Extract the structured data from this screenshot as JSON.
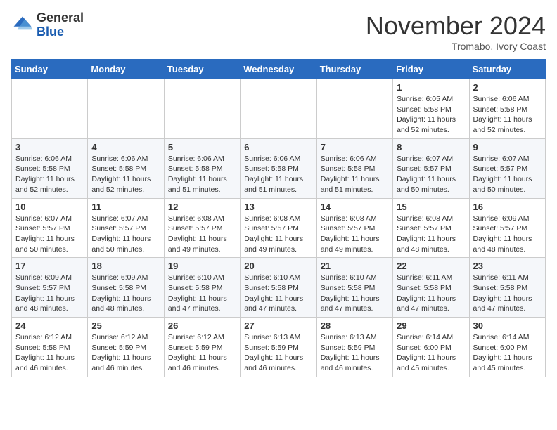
{
  "header": {
    "logo_general": "General",
    "logo_blue": "Blue",
    "month_title": "November 2024",
    "location": "Tromabo, Ivory Coast"
  },
  "days_of_week": [
    "Sunday",
    "Monday",
    "Tuesday",
    "Wednesday",
    "Thursday",
    "Friday",
    "Saturday"
  ],
  "weeks": [
    [
      {
        "day": "",
        "info": ""
      },
      {
        "day": "",
        "info": ""
      },
      {
        "day": "",
        "info": ""
      },
      {
        "day": "",
        "info": ""
      },
      {
        "day": "",
        "info": ""
      },
      {
        "day": "1",
        "info": "Sunrise: 6:05 AM\nSunset: 5:58 PM\nDaylight: 11 hours and 52 minutes."
      },
      {
        "day": "2",
        "info": "Sunrise: 6:06 AM\nSunset: 5:58 PM\nDaylight: 11 hours and 52 minutes."
      }
    ],
    [
      {
        "day": "3",
        "info": "Sunrise: 6:06 AM\nSunset: 5:58 PM\nDaylight: 11 hours and 52 minutes."
      },
      {
        "day": "4",
        "info": "Sunrise: 6:06 AM\nSunset: 5:58 PM\nDaylight: 11 hours and 52 minutes."
      },
      {
        "day": "5",
        "info": "Sunrise: 6:06 AM\nSunset: 5:58 PM\nDaylight: 11 hours and 51 minutes."
      },
      {
        "day": "6",
        "info": "Sunrise: 6:06 AM\nSunset: 5:58 PM\nDaylight: 11 hours and 51 minutes."
      },
      {
        "day": "7",
        "info": "Sunrise: 6:06 AM\nSunset: 5:58 PM\nDaylight: 11 hours and 51 minutes."
      },
      {
        "day": "8",
        "info": "Sunrise: 6:07 AM\nSunset: 5:57 PM\nDaylight: 11 hours and 50 minutes."
      },
      {
        "day": "9",
        "info": "Sunrise: 6:07 AM\nSunset: 5:57 PM\nDaylight: 11 hours and 50 minutes."
      }
    ],
    [
      {
        "day": "10",
        "info": "Sunrise: 6:07 AM\nSunset: 5:57 PM\nDaylight: 11 hours and 50 minutes."
      },
      {
        "day": "11",
        "info": "Sunrise: 6:07 AM\nSunset: 5:57 PM\nDaylight: 11 hours and 50 minutes."
      },
      {
        "day": "12",
        "info": "Sunrise: 6:08 AM\nSunset: 5:57 PM\nDaylight: 11 hours and 49 minutes."
      },
      {
        "day": "13",
        "info": "Sunrise: 6:08 AM\nSunset: 5:57 PM\nDaylight: 11 hours and 49 minutes."
      },
      {
        "day": "14",
        "info": "Sunrise: 6:08 AM\nSunset: 5:57 PM\nDaylight: 11 hours and 49 minutes."
      },
      {
        "day": "15",
        "info": "Sunrise: 6:08 AM\nSunset: 5:57 PM\nDaylight: 11 hours and 48 minutes."
      },
      {
        "day": "16",
        "info": "Sunrise: 6:09 AM\nSunset: 5:57 PM\nDaylight: 11 hours and 48 minutes."
      }
    ],
    [
      {
        "day": "17",
        "info": "Sunrise: 6:09 AM\nSunset: 5:57 PM\nDaylight: 11 hours and 48 minutes."
      },
      {
        "day": "18",
        "info": "Sunrise: 6:09 AM\nSunset: 5:58 PM\nDaylight: 11 hours and 48 minutes."
      },
      {
        "day": "19",
        "info": "Sunrise: 6:10 AM\nSunset: 5:58 PM\nDaylight: 11 hours and 47 minutes."
      },
      {
        "day": "20",
        "info": "Sunrise: 6:10 AM\nSunset: 5:58 PM\nDaylight: 11 hours and 47 minutes."
      },
      {
        "day": "21",
        "info": "Sunrise: 6:10 AM\nSunset: 5:58 PM\nDaylight: 11 hours and 47 minutes."
      },
      {
        "day": "22",
        "info": "Sunrise: 6:11 AM\nSunset: 5:58 PM\nDaylight: 11 hours and 47 minutes."
      },
      {
        "day": "23",
        "info": "Sunrise: 6:11 AM\nSunset: 5:58 PM\nDaylight: 11 hours and 47 minutes."
      }
    ],
    [
      {
        "day": "24",
        "info": "Sunrise: 6:12 AM\nSunset: 5:58 PM\nDaylight: 11 hours and 46 minutes."
      },
      {
        "day": "25",
        "info": "Sunrise: 6:12 AM\nSunset: 5:59 PM\nDaylight: 11 hours and 46 minutes."
      },
      {
        "day": "26",
        "info": "Sunrise: 6:12 AM\nSunset: 5:59 PM\nDaylight: 11 hours and 46 minutes."
      },
      {
        "day": "27",
        "info": "Sunrise: 6:13 AM\nSunset: 5:59 PM\nDaylight: 11 hours and 46 minutes."
      },
      {
        "day": "28",
        "info": "Sunrise: 6:13 AM\nSunset: 5:59 PM\nDaylight: 11 hours and 46 minutes."
      },
      {
        "day": "29",
        "info": "Sunrise: 6:14 AM\nSunset: 6:00 PM\nDaylight: 11 hours and 45 minutes."
      },
      {
        "day": "30",
        "info": "Sunrise: 6:14 AM\nSunset: 6:00 PM\nDaylight: 11 hours and 45 minutes."
      }
    ]
  ]
}
